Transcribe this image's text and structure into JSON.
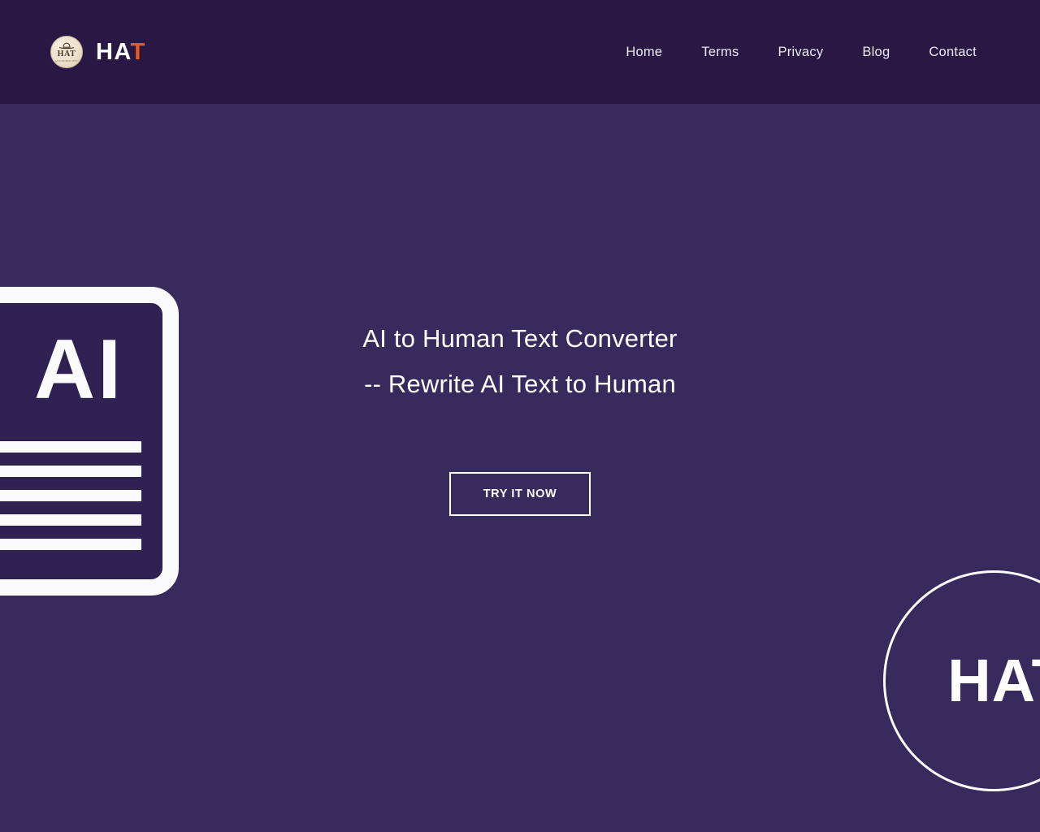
{
  "theme": {
    "header_bg": "#281843",
    "hero_bg": "#372a5c",
    "accent": "#f05a18",
    "text_light": "#ffffff",
    "nav_text": "#ece9f3",
    "badge_bg": "#ece0cb",
    "doc_fill": "#2f2252"
  },
  "header": {
    "brand": {
      "badge_word": "HAT",
      "badge_sub": "AI TO HUMAN TEXT",
      "badge_icon": "hat-icon",
      "wordmark_light": "HA",
      "wordmark_accent": "T"
    },
    "nav": [
      {
        "label": "Home"
      },
      {
        "label": "Terms"
      },
      {
        "label": "Privacy"
      },
      {
        "label": "Blog"
      },
      {
        "label": "Contact"
      }
    ]
  },
  "hero": {
    "title_line1": "AI to Human Text Converter",
    "title_line2": "-- Rewrite AI Text to Human",
    "cta_label": "TRY IT NOW",
    "decor_document": {
      "label": "AI",
      "line_count": 5
    },
    "decor_circle": {
      "label": "HAT"
    }
  }
}
